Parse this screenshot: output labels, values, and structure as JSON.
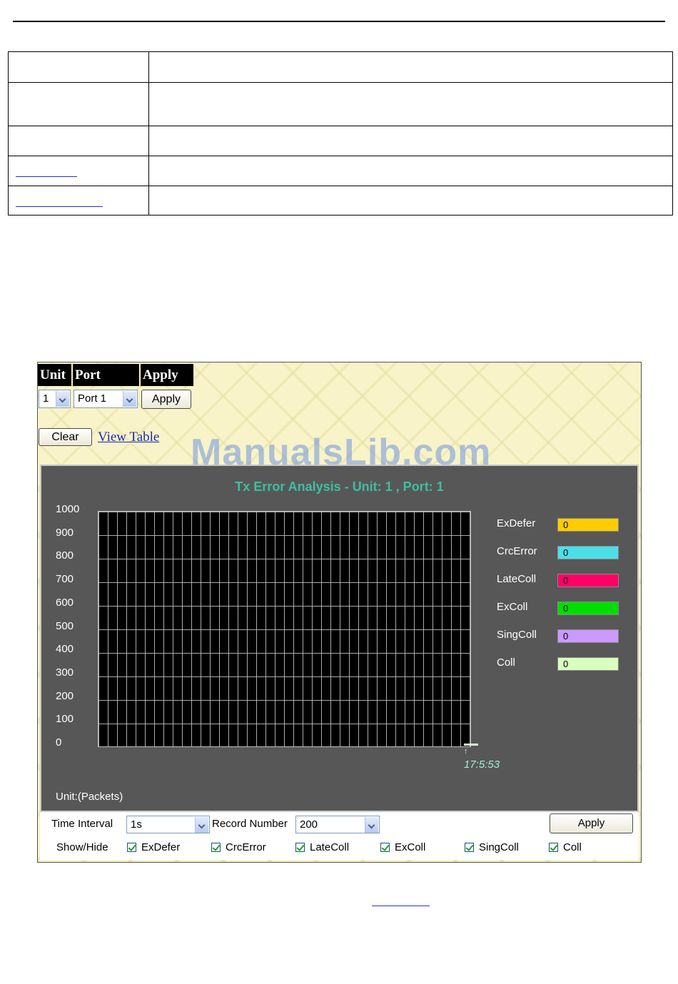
{
  "graph_panel": {
    "header": {
      "unit": "Unit",
      "port": "Port",
      "apply": "Apply"
    },
    "unit_select": "1",
    "port_select": "Port 1",
    "apply_button": "Apply",
    "clear_button": "Clear",
    "view_table_link": "View Table",
    "watermark": "ManualsLib.com",
    "units_label": "Unit:(Packets)",
    "timestamp": "17:5:53",
    "controls": {
      "time_interval_label": "Time Interval",
      "time_interval_value": "1s",
      "record_number_label": "Record Number",
      "record_number_value": "200",
      "apply_button": "Apply",
      "show_hide_label": "Show/Hide",
      "checkboxes": [
        {
          "label": "ExDefer",
          "checked": true
        },
        {
          "label": "CrcError",
          "checked": true
        },
        {
          "label": "LateColl",
          "checked": true
        },
        {
          "label": "ExColl",
          "checked": true
        },
        {
          "label": "SingColl",
          "checked": true
        },
        {
          "label": "Coll",
          "checked": true
        }
      ]
    }
  },
  "chart_data": {
    "type": "line",
    "title": "Tx Error Analysis - Unit: 1 , Port: 1",
    "ylabel": "Unit:(Packets)",
    "ylim": [
      0,
      1000
    ],
    "yticks": [
      "1000",
      "900",
      "800",
      "700",
      "600",
      "500",
      "400",
      "300",
      "200",
      "100",
      "0"
    ],
    "x": [
      "17:5:53"
    ],
    "grid": true,
    "legend_position": "right",
    "series": [
      {
        "name": "ExDefer",
        "values": [
          0
        ],
        "color": "#ffcc00"
      },
      {
        "name": "CrcError",
        "values": [
          0
        ],
        "color": "#4ddfe8"
      },
      {
        "name": "LateColl",
        "values": [
          0
        ],
        "color": "#ff0066"
      },
      {
        "name": "ExColl",
        "values": [
          0
        ],
        "color": "#00dd00"
      },
      {
        "name": "SingColl",
        "values": [
          0
        ],
        "color": "#cc99ff"
      },
      {
        "name": "Coll",
        "values": [
          0
        ],
        "color": "#d9ffbf"
      }
    ]
  }
}
